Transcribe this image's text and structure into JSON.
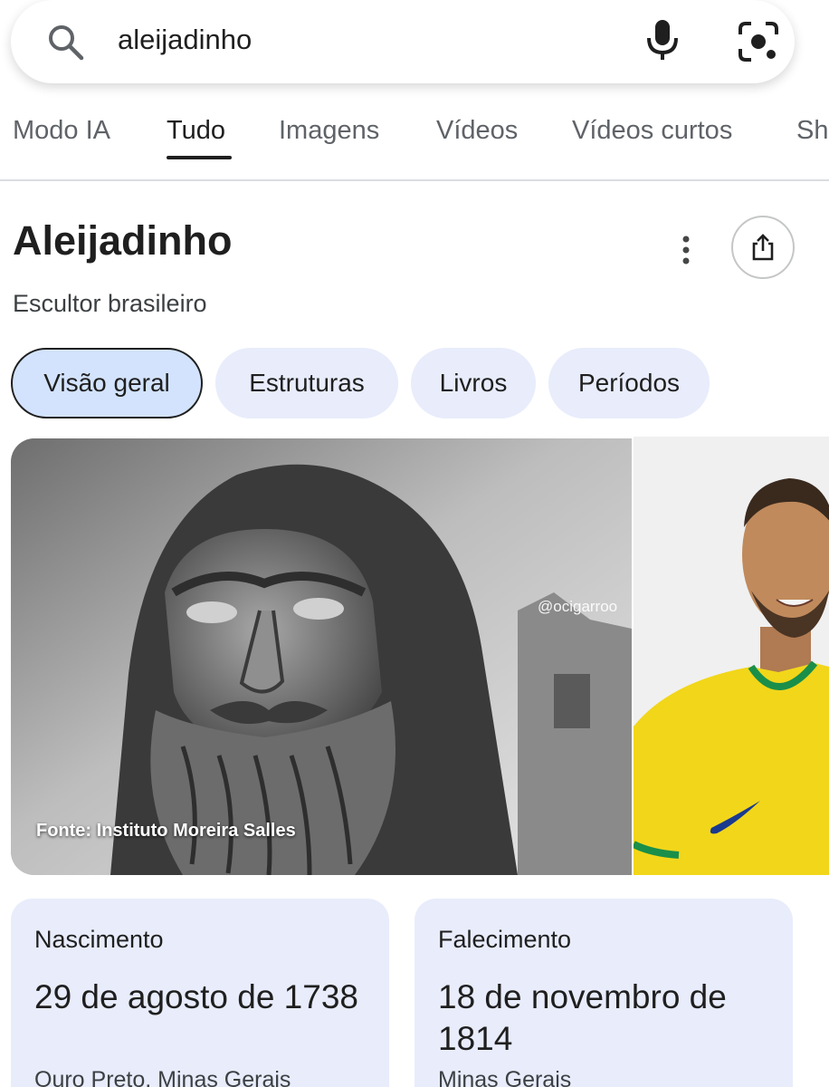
{
  "search": {
    "query": "aleijadinho",
    "icons": {
      "search": "search-icon",
      "voice": "mic-icon",
      "lens": "lens-icon"
    }
  },
  "tabs": [
    {
      "label": "Modo IA",
      "active": false
    },
    {
      "label": "Tudo",
      "active": true
    },
    {
      "label": "Imagens",
      "active": false
    },
    {
      "label": "Vídeos",
      "active": false
    },
    {
      "label": "Vídeos curtos",
      "active": false
    },
    {
      "label": "Sh",
      "active": false
    }
  ],
  "knowledge_panel": {
    "title": "Aleijadinho",
    "subtitle": "Escultor brasileiro",
    "icons": {
      "more": "more-vert-icon",
      "share": "share-icon"
    },
    "chips": [
      {
        "label": "Visão geral",
        "selected": true
      },
      {
        "label": "Estruturas",
        "selected": false
      },
      {
        "label": "Livros",
        "selected": false
      },
      {
        "label": "Períodos",
        "selected": false
      }
    ],
    "images": {
      "main_watermark": "@ocigarroo",
      "main_caption": "Fonte: Instituto Moreira Salles"
    },
    "facts": [
      {
        "label": "Nascimento",
        "date": "29 de agosto de 1738",
        "place": "Ouro Preto, Minas Gerais"
      },
      {
        "label": "Falecimento",
        "date": "18 de novembro de 1814",
        "place": "Minas Gerais"
      }
    ]
  },
  "colors": {
    "chip_bg": "#e8ecfb",
    "chip_selected_bg": "#d3e3fd",
    "card_bg": "#e8ecfb",
    "jersey_yellow": "#f2d61a",
    "jersey_green": "#1a8f4a"
  }
}
